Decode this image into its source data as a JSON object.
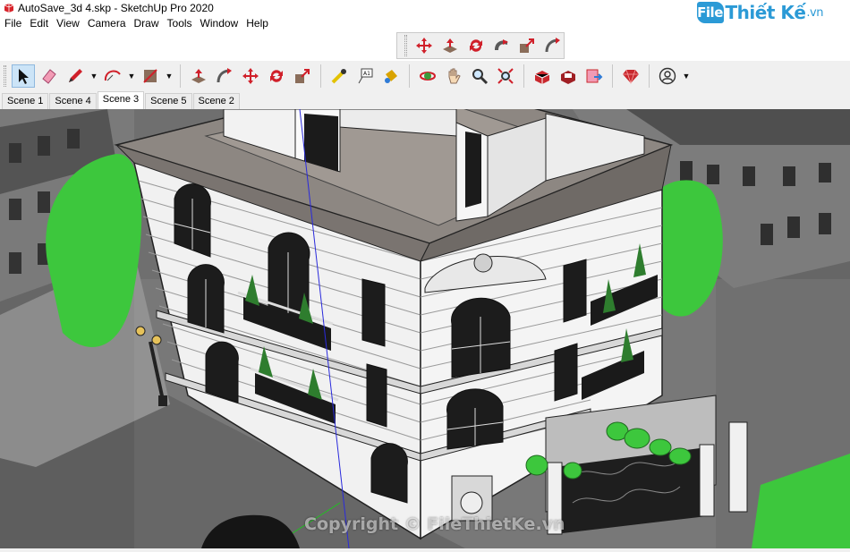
{
  "window": {
    "title": "AutoSave_3d 4.skp - SketchUp Pro 2020",
    "brand": {
      "name": "FileThiết Kế",
      "domain": ".vn"
    }
  },
  "menu": {
    "items": [
      "File",
      "Edit",
      "View",
      "Camera",
      "Draw",
      "Tools",
      "Window",
      "Help"
    ]
  },
  "floating_toolbar": {
    "icons": [
      "move-icon",
      "push-pull-icon",
      "rotate-icon",
      "follow-me-icon",
      "scale-icon",
      "offset-icon"
    ]
  },
  "main_toolbar": {
    "groups": [
      [
        "select-icon",
        "eraser-icon",
        "pencil-icon",
        "arc-icon",
        "shapes-icon"
      ],
      [
        "push-pull-icon",
        "offset-icon",
        "move-icon",
        "rotate-icon",
        "scale-icon"
      ],
      [
        "tape-measure-icon",
        "text-icon",
        "paint-bucket-icon"
      ],
      [
        "orbit-icon",
        "pan-icon",
        "zoom-icon",
        "zoom-extents-icon"
      ],
      [
        "warehouse-icon",
        "extension-warehouse-icon",
        "send-to-layout-icon"
      ],
      [
        "ruby-icon"
      ],
      [
        "account-icon"
      ]
    ]
  },
  "scenes": {
    "tabs": [
      "Scene 1",
      "Scene 4",
      "Scene 3",
      "Scene 5",
      "Scene 2"
    ],
    "active": "Scene 3"
  },
  "viewport": {
    "watermark": "Copyright © FileThietKe.vn"
  },
  "colors": {
    "accent": "#2b9ad6",
    "tree": "#3dc73d",
    "wall": "#f2f2f2",
    "roof": "#8a8580",
    "street": "#6e6e6e"
  }
}
